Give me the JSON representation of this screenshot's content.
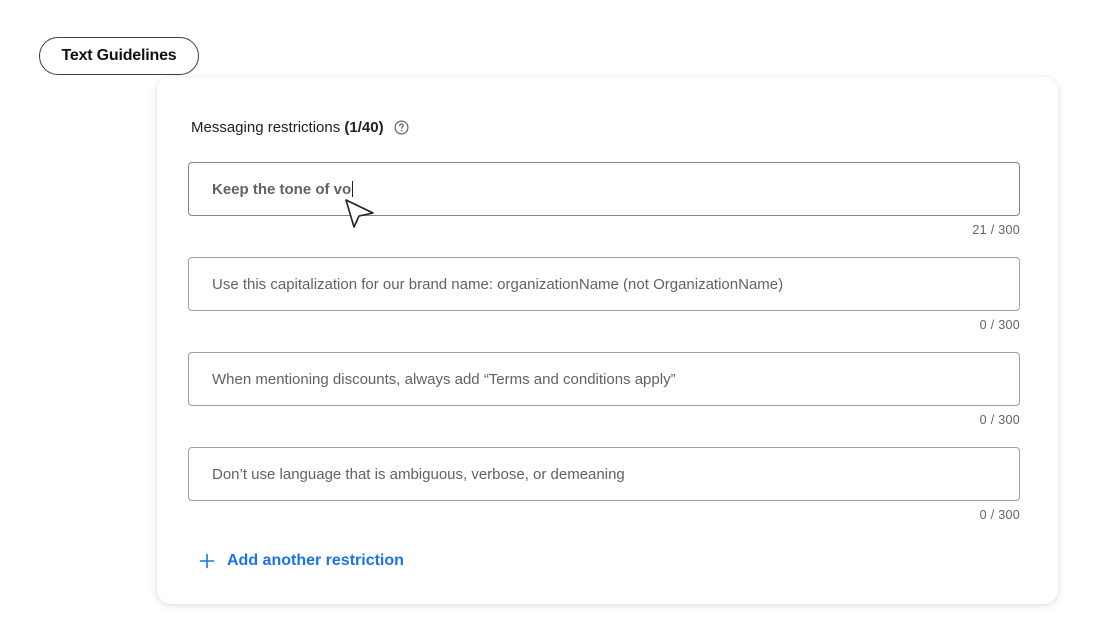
{
  "header": {
    "pill_label": "Text Guidelines"
  },
  "section": {
    "title": "Messaging restrictions",
    "count": "(1/40)",
    "help_icon": "help-circle-icon"
  },
  "fields": [
    {
      "value": "Keep the tone of vo",
      "counter": "21 / 300",
      "active": true
    },
    {
      "placeholder": "Use this capitalization for our brand name: organizationName (not OrganizationName)",
      "counter": "0 / 300"
    },
    {
      "placeholder": "When mentioning discounts, always add “Terms and conditions apply”",
      "counter": "0 / 300"
    },
    {
      "placeholder": "Don’t use language that is ambiguous, verbose, or demeaning",
      "counter": "0 / 300"
    }
  ],
  "add_button": {
    "label": "Add another restriction",
    "icon": "plus-icon"
  },
  "colors": {
    "accent": "#1a73e8",
    "border": "#9aa0a6",
    "text_secondary": "#5f6368"
  }
}
